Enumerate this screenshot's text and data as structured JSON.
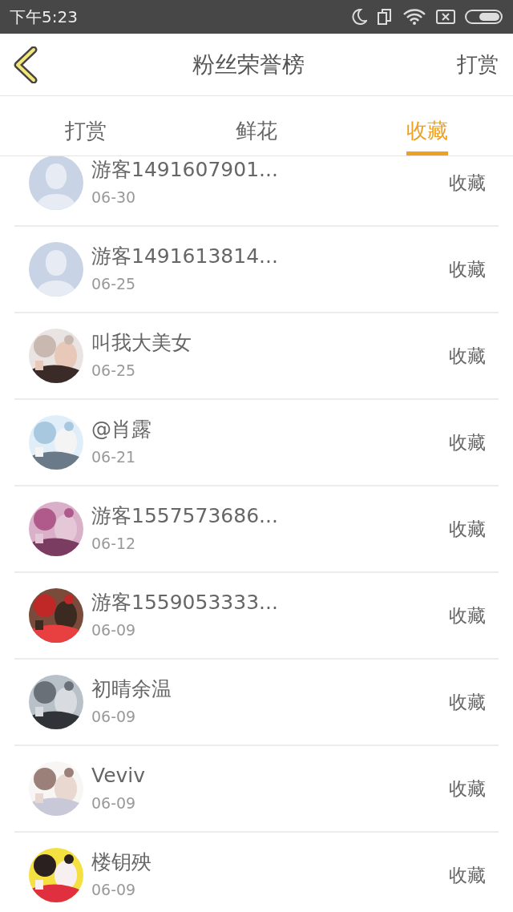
{
  "status_bar": {
    "time": "下午5:23"
  },
  "header": {
    "title": "粉丝荣誉榜",
    "action": "打赏"
  },
  "tabs": [
    {
      "label": "打赏",
      "selected": false
    },
    {
      "label": "鲜花",
      "selected": false
    },
    {
      "label": "收藏",
      "selected": true
    }
  ],
  "fans": [
    {
      "name": "游客1491607901...",
      "date": "06-30",
      "action": "收藏",
      "kind": "default"
    },
    {
      "name": "游客1491613814...",
      "date": "06-25",
      "action": "收藏",
      "kind": "default"
    },
    {
      "name": "叫我大美女",
      "date": "06-25",
      "action": "收藏",
      "kind": "picture"
    },
    {
      "name": "@肖露",
      "date": "06-21",
      "action": "收藏",
      "kind": "picture"
    },
    {
      "name": "游客1557573686...",
      "date": "06-12",
      "action": "收藏",
      "kind": "picture"
    },
    {
      "name": "游客1559053333...",
      "date": "06-09",
      "action": "收藏",
      "kind": "picture"
    },
    {
      "name": "初晴余温",
      "date": "06-09",
      "action": "收藏",
      "kind": "picture"
    },
    {
      "name": "Veviv",
      "date": "06-09",
      "action": "收藏",
      "kind": "picture"
    },
    {
      "name": "楼钥殃",
      "date": "06-09",
      "action": "收藏",
      "kind": "picture"
    }
  ]
}
